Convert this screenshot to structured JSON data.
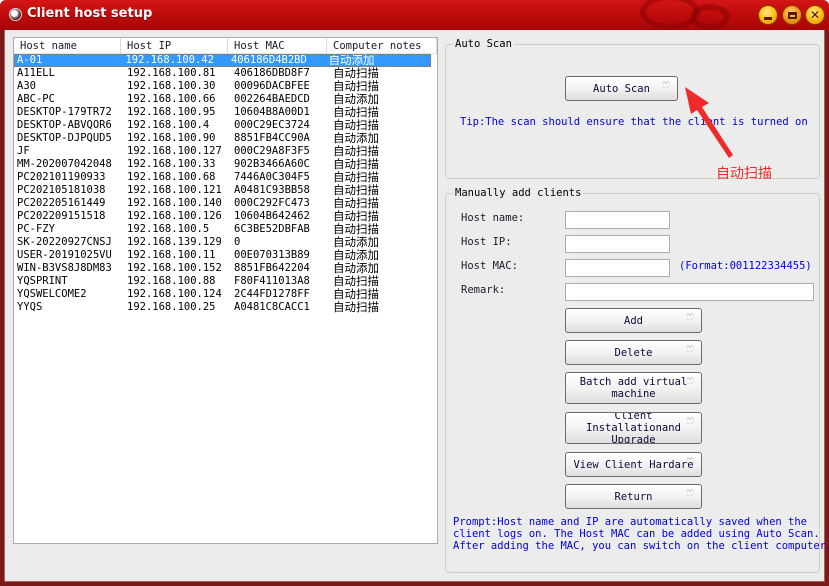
{
  "window": {
    "title": "Client host setup",
    "controls": {
      "minimize": "minimize",
      "maximize": "maximize",
      "close": "close"
    },
    "accent_color": "#c00c0c"
  },
  "host_list": {
    "columns": [
      "Host name",
      "Host IP",
      "Host MAC",
      "Computer notes"
    ],
    "selected_index": 0,
    "rows": [
      {
        "name": "A-01",
        "ip": "192.168.100.42",
        "mac": "406186D4B2BD",
        "notes": "自动添加"
      },
      {
        "name": "A11ELL",
        "ip": "192.168.100.81",
        "mac": "406186DBD8F7",
        "notes": "自动扫描"
      },
      {
        "name": "A30",
        "ip": "192.168.100.30",
        "mac": "00096DACBFEE",
        "notes": "自动扫描"
      },
      {
        "name": "ABC-PC",
        "ip": "192.168.100.66",
        "mac": "002264BAEDCD",
        "notes": "自动添加"
      },
      {
        "name": "DESKTOP-179TR72",
        "ip": "192.168.100.95",
        "mac": "10604B8A00D1",
        "notes": "自动扫描"
      },
      {
        "name": "DESKTOP-ABVQOR6",
        "ip": "192.168.100.4",
        "mac": "000C29EC3724",
        "notes": "自动扫描"
      },
      {
        "name": "DESKTOP-DJPQUD5",
        "ip": "192.168.100.90",
        "mac": "8851FB4CC90A",
        "notes": "自动添加"
      },
      {
        "name": "JF",
        "ip": "192.168.100.127",
        "mac": "000C29A8F3F5",
        "notes": "自动扫描"
      },
      {
        "name": "MM-202007042048",
        "ip": "192.168.100.33",
        "mac": "902B3466A60C",
        "notes": "自动扫描"
      },
      {
        "name": "PC202101190933",
        "ip": "192.168.100.68",
        "mac": "7446A0C304F5",
        "notes": "自动扫描"
      },
      {
        "name": "PC202105181038",
        "ip": "192.168.100.121",
        "mac": "A0481C93BB58",
        "notes": "自动扫描"
      },
      {
        "name": "PC202205161449",
        "ip": "192.168.100.140",
        "mac": "000C292FC473",
        "notes": "自动扫描"
      },
      {
        "name": "PC202209151518",
        "ip": "192.168.100.126",
        "mac": "10604B642462",
        "notes": "自动扫描"
      },
      {
        "name": "PC-FZY",
        "ip": "192.168.100.5",
        "mac": "6C3BE52DBFAB",
        "notes": "自动扫描"
      },
      {
        "name": "SK-20220927CNSJ",
        "ip": "192.168.139.129",
        "mac": "0",
        "notes": "自动添加"
      },
      {
        "name": "USER-20191025VU",
        "ip": "192.168.100.11",
        "mac": "00E070313B89",
        "notes": "自动添加"
      },
      {
        "name": "WIN-B3VS8J8DM83",
        "ip": "192.168.100.152",
        "mac": "8851FB642204",
        "notes": "自动添加"
      },
      {
        "name": "YQSPRINT",
        "ip": "192.168.100.88",
        "mac": "F80F411013A8",
        "notes": "自动扫描"
      },
      {
        "name": "YQSWELCOME2",
        "ip": "192.168.100.124",
        "mac": "2C44FD1278FF",
        "notes": "自动扫描"
      },
      {
        "name": "YYQS",
        "ip": "192.168.100.25",
        "mac": "A0481C8CACC1",
        "notes": "自动扫描"
      }
    ]
  },
  "auto_scan": {
    "group_label": "Auto Scan",
    "button_label": "Auto Scan",
    "tip": "Tip:The scan should ensure that the client is turned on",
    "annotation": "自动扫描",
    "annotation_color": "#ee2a2a"
  },
  "manual": {
    "group_label": "Manually add clients",
    "fields": {
      "host_name": {
        "label": "Host name:",
        "value": ""
      },
      "host_ip": {
        "label": "Host IP:",
        "value": ""
      },
      "host_mac": {
        "label": "Host MAC:",
        "value": "",
        "hint": "(Format:001122334455)"
      },
      "remark": {
        "label": "Remark:",
        "value": ""
      }
    },
    "buttons": {
      "add": "Add",
      "delete": "Delete",
      "batch_add": "Batch add virtual machine",
      "client_install": "Client Installationand Upgrade",
      "view_hardware": "View Client Hardare",
      "return": "Return"
    },
    "prompt_lines": [
      "Prompt:Host name and IP are automatically saved when the",
      "client logs on. The Host MAC can be added using Auto Scan.",
      "After adding the MAC, you can switch on the client computer."
    ],
    "tip_color": "#0000e0"
  }
}
